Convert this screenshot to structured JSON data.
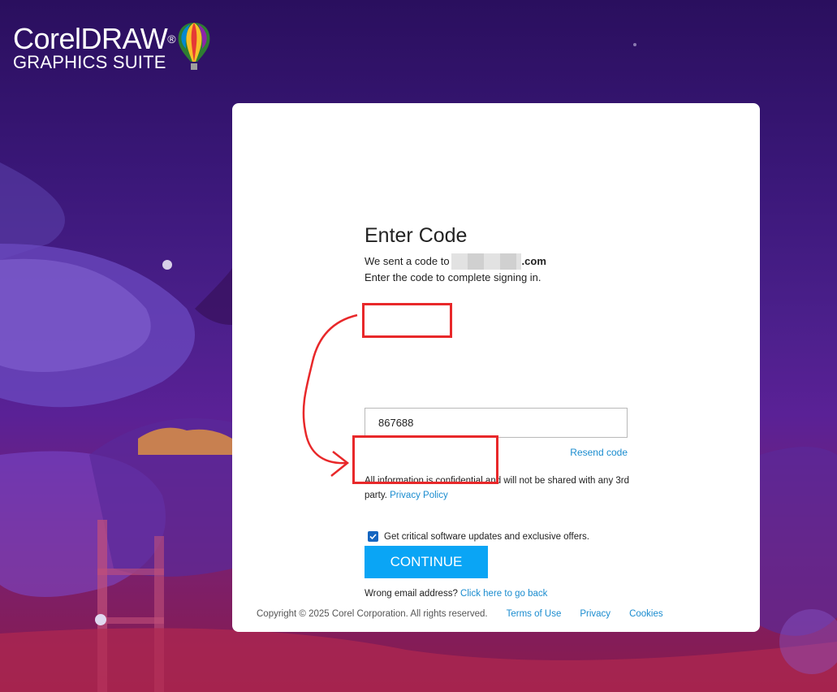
{
  "brand": {
    "name_line1": "CorelDRAW",
    "registered": "®",
    "name_line2": "GRAPHICS SUITE",
    "logo_icon": "hot-air-balloon-icon"
  },
  "form": {
    "title": "Enter Code",
    "sent_prefix": "We sent a code to",
    "sent_email_suffix": ".com",
    "instruction": "Enter the code to complete signing in.",
    "code_value": "867688",
    "resend_label": "Resend code",
    "confidential_text": "All information is confidential and will not be shared with any 3rd party.",
    "privacy_policy_label": "Privacy Policy",
    "updates_checkbox_label": "Get critical software updates and exclusive offers.",
    "updates_checked": true,
    "continue_label": "CONTINUE",
    "wrong_email_text": "Wrong email address?",
    "go_back_label": "Click here to go back"
  },
  "footer": {
    "copyright": "Copyright © 2025 Corel Corporation. All rights reserved.",
    "terms_label": "Terms of Use",
    "privacy_label": "Privacy",
    "cookies_label": "Cookies"
  },
  "colors": {
    "accent_button": "#0aa5f5",
    "link": "#1a8ccf",
    "annotation": "#e8282a",
    "checkbox": "#1565c0"
  }
}
